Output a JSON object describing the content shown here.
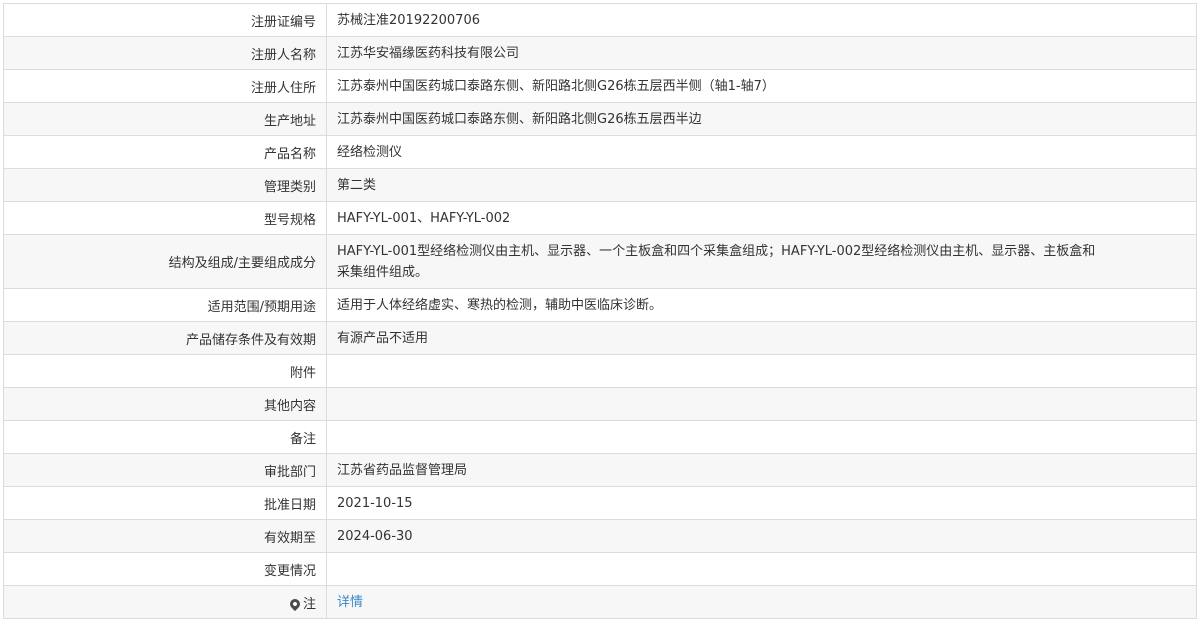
{
  "rows": [
    {
      "label": "注册证编号",
      "value": "苏械注准20192200706"
    },
    {
      "label": "注册人名称",
      "value": "江苏华安福缘医药科技有限公司"
    },
    {
      "label": "注册人住所",
      "value": "江苏泰州中国医药城口泰路东侧、新阳路北侧G26栋五层西半侧（轴1-轴7）"
    },
    {
      "label": "生产地址",
      "value": "江苏泰州中国医药城口泰路东侧、新阳路北侧G26栋五层西半边"
    },
    {
      "label": "产品名称",
      "value": "经络检测仪"
    },
    {
      "label": "管理类别",
      "value": "第二类"
    },
    {
      "label": "型号规格",
      "value": "HAFY-YL-001、HAFY-YL-002"
    },
    {
      "label": "结构及组成/主要组成成分",
      "value_line1": "HAFY-YL-001型经络检测仪由主机、显示器、一个主板盒和四个采集盒组成；HAFY-YL-002型经络检测仪由主机、显示器、主板盒和",
      "value_line2": "采集组件组成。"
    },
    {
      "label": "适用范围/预期用途",
      "value": "适用于人体经络虚实、寒热的检测，辅助中医临床诊断。"
    },
    {
      "label": "产品储存条件及有效期",
      "value": "有源产品不适用"
    },
    {
      "label": "附件",
      "value": ""
    },
    {
      "label": "其他内容",
      "value": ""
    },
    {
      "label": "备注",
      "value": ""
    },
    {
      "label": "审批部门",
      "value": "江苏省药品监督管理局"
    },
    {
      "label": "批准日期",
      "value": "2021-10-15"
    },
    {
      "label": "有效期至",
      "value": "2024-06-30"
    },
    {
      "label": "变更情况",
      "value": ""
    },
    {
      "label": "注",
      "value": "详情",
      "icon": "map-pin-icon",
      "link_color": "#3a87c8"
    }
  ]
}
